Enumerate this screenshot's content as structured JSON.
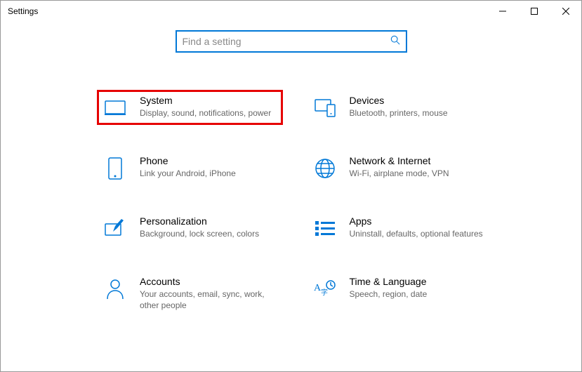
{
  "window": {
    "title": "Settings"
  },
  "search": {
    "placeholder": "Find a setting"
  },
  "categories": [
    {
      "title": "System",
      "desc": "Display, sound, notifications, power",
      "highlight": true
    },
    {
      "title": "Devices",
      "desc": "Bluetooth, printers, mouse"
    },
    {
      "title": "Phone",
      "desc": "Link your Android, iPhone"
    },
    {
      "title": "Network & Internet",
      "desc": "Wi-Fi, airplane mode, VPN"
    },
    {
      "title": "Personalization",
      "desc": "Background, lock screen, colors"
    },
    {
      "title": "Apps",
      "desc": "Uninstall, defaults, optional features"
    },
    {
      "title": "Accounts",
      "desc": "Your accounts, email, sync, work, other people"
    },
    {
      "title": "Time & Language",
      "desc": "Speech, region, date"
    }
  ],
  "colors": {
    "accent": "#0078d7",
    "highlight_border": "#e60000"
  }
}
